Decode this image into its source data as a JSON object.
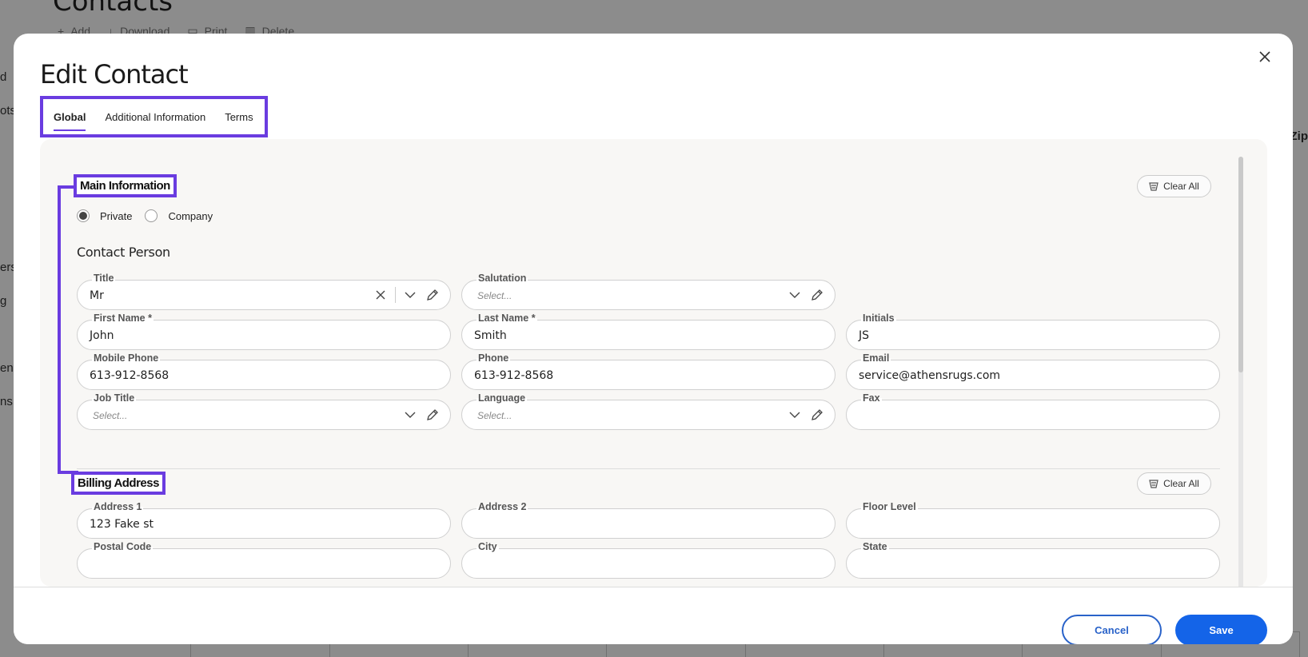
{
  "background": {
    "page_title": "Contacts",
    "toolbar": [
      "Add",
      "Download",
      "Print",
      "Delete"
    ],
    "side_fragments": [
      "d",
      "ots",
      "ers",
      "g",
      "en",
      "ns"
    ],
    "right_fragment": "Zip"
  },
  "modal": {
    "title": "Edit Contact",
    "tabs": [
      {
        "label": "Global",
        "active": true
      },
      {
        "label": "Additional Information",
        "active": false
      },
      {
        "label": "Terms",
        "active": false
      }
    ],
    "main_info": {
      "heading": "Main Information",
      "clear_all": "Clear All",
      "type_options": [
        {
          "label": "Private",
          "checked": true
        },
        {
          "label": "Company",
          "checked": false
        }
      ],
      "contact_person_heading": "Contact Person",
      "fields": {
        "title": {
          "label": "Title",
          "value": "Mr"
        },
        "salutation": {
          "label": "Salutation",
          "placeholder": "Select..."
        },
        "first_name": {
          "label": "First Name *",
          "value": "John"
        },
        "last_name": {
          "label": "Last Name *",
          "value": "Smith"
        },
        "initials": {
          "label": "Initials",
          "value": "JS"
        },
        "mobile_phone": {
          "label": "Mobile Phone",
          "value": "613-912-8568"
        },
        "phone": {
          "label": "Phone",
          "value": "613-912-8568"
        },
        "email": {
          "label": "Email",
          "value": "service@athensrugs.com"
        },
        "job_title": {
          "label": "Job Title",
          "placeholder": "Select..."
        },
        "language": {
          "label": "Language",
          "placeholder": "Select..."
        },
        "fax": {
          "label": "Fax",
          "value": ""
        }
      }
    },
    "billing": {
      "heading": "Billing Address",
      "clear_all": "Clear All",
      "fields": {
        "address1": {
          "label": "Address 1",
          "value": "123 Fake st"
        },
        "address2": {
          "label": "Address 2",
          "value": ""
        },
        "floor_level": {
          "label": "Floor Level",
          "value": ""
        },
        "postal_code": {
          "label": "Postal Code"
        },
        "city": {
          "label": "City"
        },
        "state": {
          "label": "State"
        }
      }
    },
    "footer": {
      "cancel": "Cancel",
      "save": "Save"
    }
  },
  "colors": {
    "accent": "#6a3ce0",
    "primary": "#1464e8"
  }
}
